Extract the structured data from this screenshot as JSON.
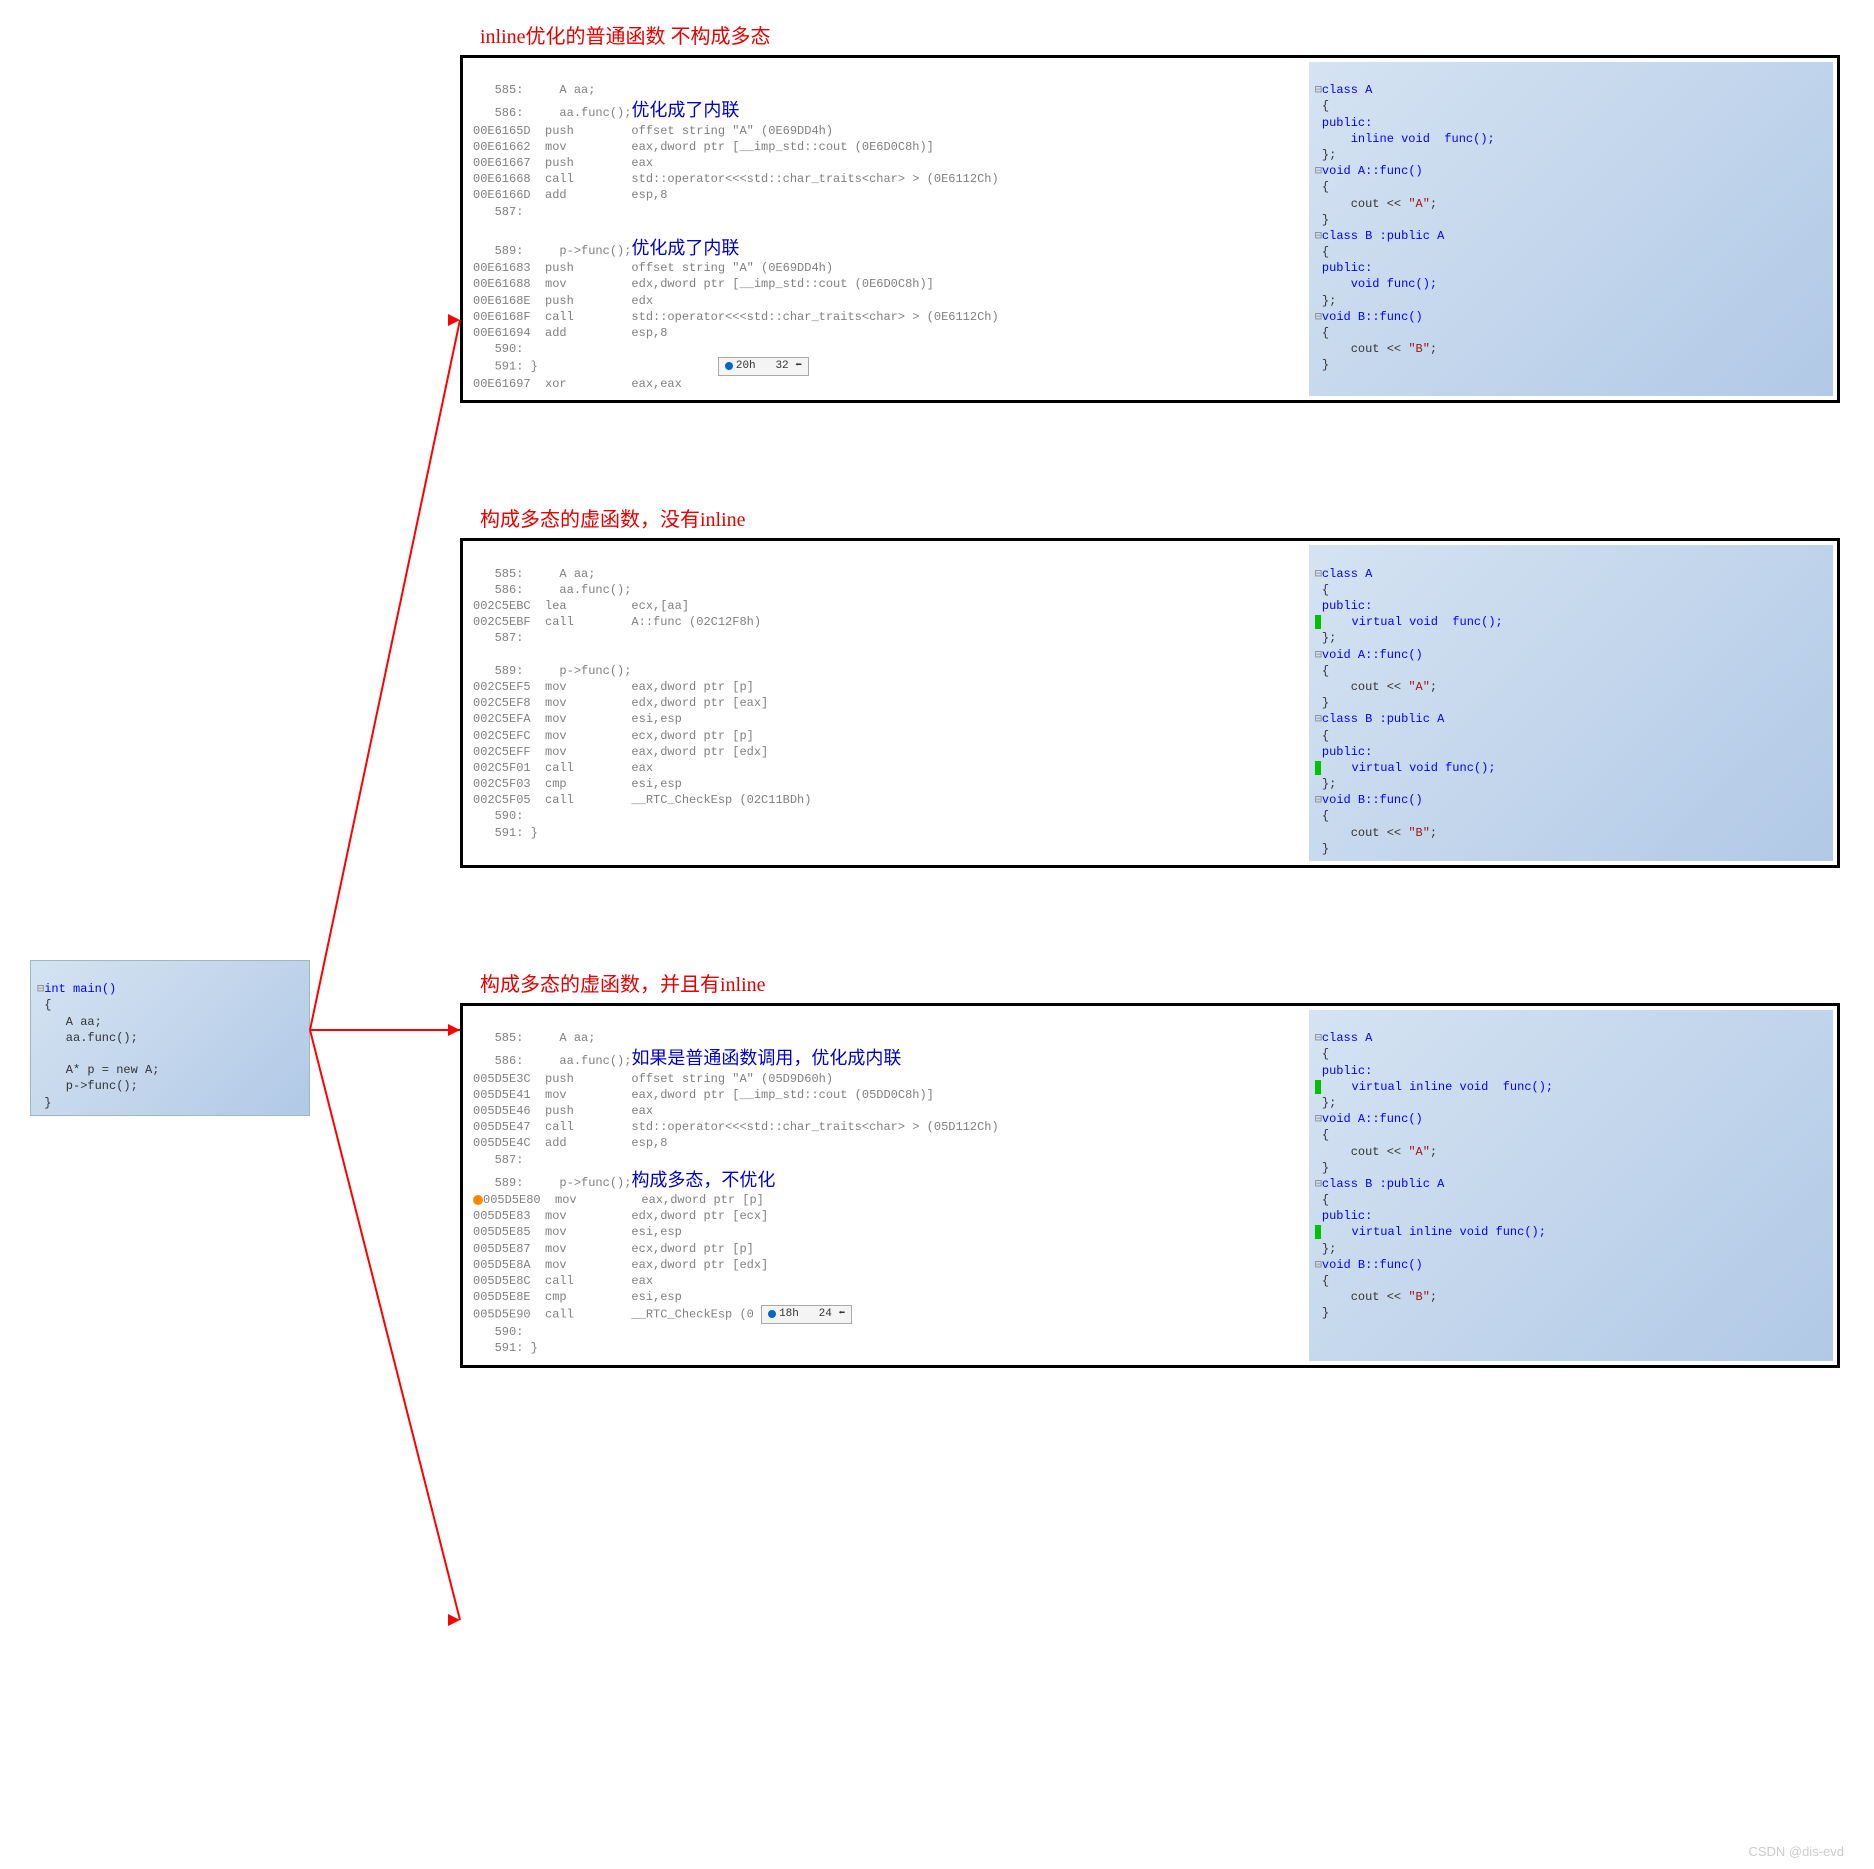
{
  "main_src": {
    "l1": "int main()",
    "l2": "{",
    "l3": "    A aa;",
    "l4": "    aa.func();",
    "l5": "",
    "l6": "    A* p = new A;",
    "l7": "    p->func();",
    "l8": "}"
  },
  "panel1": {
    "title": "inline优化的普通函数 不构成多态",
    "asm": {
      "l1": "   585:     A aa;",
      "l2": "   586:     aa.func();",
      "ann1": "优化成了内联",
      "l3": "00E6165D  push        offset string \"A\" (0E69DD4h)",
      "l4": "00E61662  mov         eax,dword ptr [__imp_std::cout (0E6D0C8h)]",
      "l5": "00E61667  push        eax",
      "l6": "00E61668  call        std::operator<<<std::char_traits<char> > (0E6112Ch)",
      "l7": "00E6166D  add         esp,8",
      "l8": "   587:",
      "l9": "   589:     p->func();",
      "ann2": "优化成了内联",
      "l10": "00E61683  push        offset string \"A\" (0E69DD4h)",
      "l11": "00E61688  mov         edx,dword ptr [__imp_std::cout (0E6D0C8h)]",
      "l12": "00E6168E  push        edx",
      "l13": "00E6168F  call        std::operator<<<std::char_traits<char> > (0E6112Ch)",
      "l14": "00E61694  add         esp,8",
      "l15": "   590:",
      "l16": "   591: }",
      "l17": "00E61697  xor         eax,eax",
      "badge": "20h   32"
    },
    "src": {
      "l1": "class A",
      "l2": "{",
      "l3": "public:",
      "l4": "    inline void  func();",
      "l5": "};",
      "l6": "void A::func()",
      "l7": "{",
      "l8": "    cout << \"A\";",
      "l9": "}",
      "l10": "class B :public A",
      "l11": "{",
      "l12": "public:",
      "l13": "    void func();",
      "l14": "};",
      "l15": "void B::func()",
      "l16": "{",
      "l17": "    cout << \"B\";",
      "l18": "}"
    }
  },
  "panel2": {
    "title": "构成多态的虚函数，没有inline",
    "asm": {
      "l1": "   585:     A aa;",
      "l2": "   586:     aa.func();",
      "l3": "002C5EBC  lea         ecx,[aa]",
      "l4": "002C5EBF  call        A::func (02C12F8h)",
      "l5": "   587:",
      "l6": "   589:     p->func();",
      "l7": "002C5EF5  mov         eax,dword ptr [p]",
      "l8": "002C5EF8  mov         edx,dword ptr [eax]",
      "l9": "002C5EFA  mov         esi,esp",
      "l10": "002C5EFC  mov         ecx,dword ptr [p]",
      "l11": "002C5EFF  mov         eax,dword ptr [edx]",
      "l12": "002C5F01  call        eax",
      "l13": "002C5F03  cmp         esi,esp",
      "l14": "002C5F05  call        __RTC_CheckEsp (02C11BDh)",
      "l15": "   590:",
      "l16": "   591: }"
    },
    "src": {
      "l1": "class A",
      "l2": "{",
      "l3": "public:",
      "l4": "    virtual void  func();",
      "l5": "};",
      "l6": "void A::func()",
      "l7": "{",
      "l8": "    cout << \"A\";",
      "l9": "}",
      "l10": "class B :public A",
      "l11": "{",
      "l12": "public:",
      "l13": "    virtual void func();",
      "l14": "};",
      "l15": "void B::func()",
      "l16": "{",
      "l17": "    cout << \"B\";",
      "l18": "}"
    }
  },
  "panel3": {
    "title": "构成多态的虚函数，并且有inline",
    "asm": {
      "l1": "   585:     A aa;",
      "l2": "   586:     aa.func();",
      "ann1": "如果是普通函数调用，优化成内联",
      "l3": "005D5E3C  push        offset string \"A\" (05D9D60h)",
      "l4": "005D5E41  mov         eax,dword ptr [__imp_std::cout (05DD0C8h)]",
      "l5": "005D5E46  push        eax",
      "l6": "005D5E47  call        std::operator<<<std::char_traits<char> > (05D112Ch)",
      "l7": "005D5E4C  add         esp,8",
      "l8": "   587:",
      "l9": "   589:     p->func();",
      "ann2": "构成多态，不优化",
      "l10": "005D5E80  mov         eax,dword ptr [p]",
      "l11": "005D5E83  mov         edx,dword ptr [ecx]",
      "l12": "005D5E85  mov         esi,esp",
      "l13": "005D5E87  mov         ecx,dword ptr [p]",
      "l14": "005D5E8A  mov         eax,dword ptr [edx]",
      "l15": "005D5E8C  call        eax",
      "l16": "005D5E8E  cmp         esi,esp",
      "l17": "005D5E90  call        __RTC_CheckEsp (0",
      "l18": "   590:",
      "l19": "   591: }",
      "badge": "18h   24"
    },
    "src": {
      "l1": "class A",
      "l2": "{",
      "l3": "public:",
      "l4": "    virtual inline void  func();",
      "l5": "};",
      "l6": "void A::func()",
      "l7": "{",
      "l8": "    cout << \"A\";",
      "l9": "}",
      "l10": "class B :public A",
      "l11": "{",
      "l12": "public:",
      "l13": "    virtual inline void func();",
      "l14": "};",
      "l15": "void B::func()",
      "l16": "{",
      "l17": "    cout << \"B\";",
      "l18": "}"
    }
  },
  "watermark": "CSDN @dis-evd"
}
